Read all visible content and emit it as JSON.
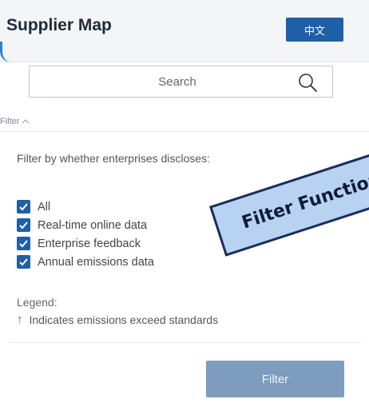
{
  "header": {
    "title": "Supplier Map",
    "lang_button": "中文"
  },
  "search": {
    "placeholder": "Search"
  },
  "filter": {
    "toggle_label": "Filter",
    "description": "Filter by whether enterprises discloses:",
    "options": [
      {
        "label": "All",
        "checked": true
      },
      {
        "label": "Real-time online data",
        "checked": true
      },
      {
        "label": "Enterprise feedback",
        "checked": true
      },
      {
        "label": "Annual emissions data",
        "checked": true
      }
    ],
    "submit_label": "Filter"
  },
  "legend": {
    "label": "Legend:",
    "item": "Indicates emissions exceed standards",
    "item_icon": "up-arrow-icon",
    "item_color": "#d9342b"
  },
  "annotation": {
    "text": "Filter Function"
  },
  "colors": {
    "primary": "#1f5fa8",
    "filter_button": "#7e9cbd",
    "annotation_bg": "#b7d3f1"
  }
}
